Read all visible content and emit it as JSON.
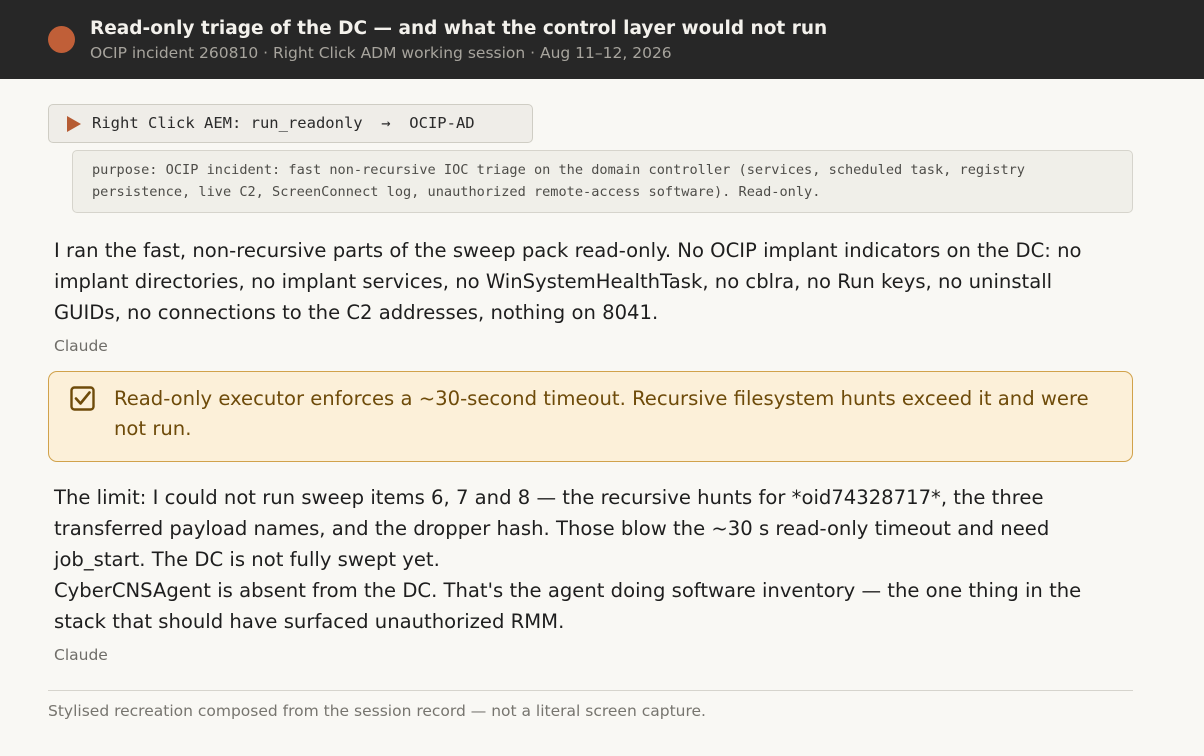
{
  "header": {
    "title": "Read-only triage of the DC — and what the control layer would not run",
    "subtitle": "OCIP incident 260810 · Right Click ADM working session · Aug 11–12, 2026",
    "logo_color": "#c05f38"
  },
  "tool_call": {
    "icon": "play-icon",
    "label": "Right Click AEM: run_readonly  →  OCIP-AD",
    "purpose": "purpose: OCIP incident: fast non-recursive IOC triage on the domain controller (services, scheduled task, registry persistence, live C2, ScreenConnect log, unauthorized remote-access software). Read-only."
  },
  "messages": [
    {
      "text": "I ran the fast, non-recursive parts of the sweep pack read-only. No OCIP implant indicators on the DC: no implant directories, no implant services, no WinSystemHealthTask, no cblra, no Run keys, no uninstall GUIDs, no connections to the C2 addresses, nothing on 8041.",
      "author": "Claude"
    },
    {
      "text_1": "The limit: I could not run sweep items 6, 7 and 8 — the recursive hunts for *oid74328717*, the three transferred payload names, and the dropper hash. Those blow the ~30 s read-only timeout and need job_start. The DC is not fully swept yet.",
      "text_2": "CyberCNSAgent is absent from the DC. That's the agent doing software inventory — the one thing in the stack that should have surfaced unauthorized RMM.",
      "author": "Claude"
    }
  ],
  "callout": {
    "icon": "checkbox-checked-icon",
    "text": "Read-only executor enforces a ~30-second timeout. Recursive filesystem hunts exceed it and were not run.",
    "accent_color": "#d1a24b"
  },
  "footnote": "Stylised recreation composed from the session record — not a literal screen capture."
}
